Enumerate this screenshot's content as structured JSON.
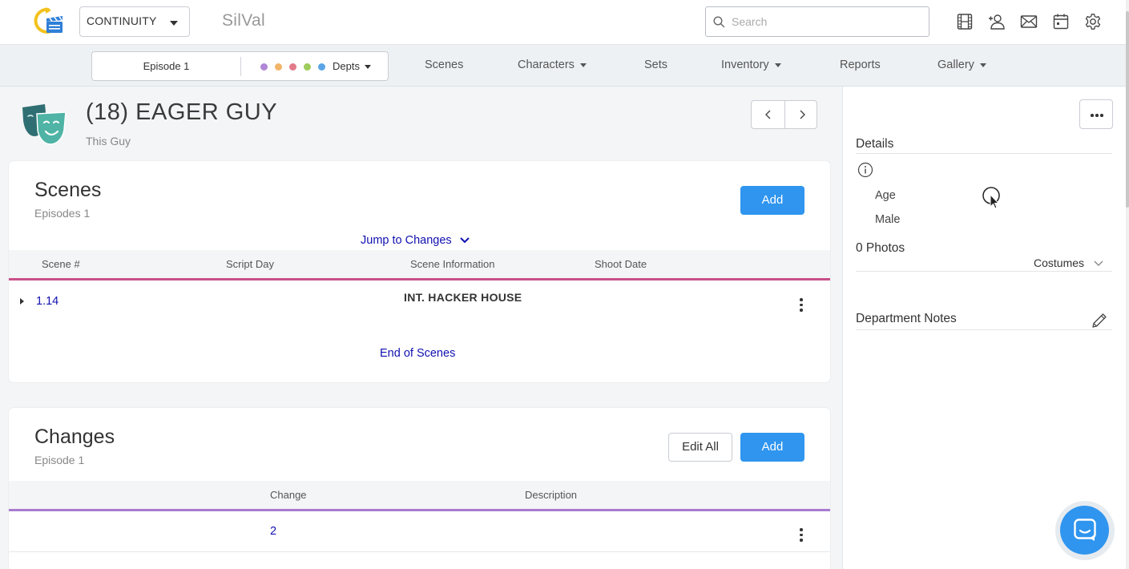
{
  "topbar": {
    "app_select": "CONTINUITY",
    "project_name": "SilVal",
    "search_placeholder": "Search",
    "icons": [
      "film-icon",
      "add-user-icon",
      "mail-icon",
      "calendar-icon",
      "gear-icon"
    ]
  },
  "nav": {
    "episode": "Episode 1",
    "depts_label": "Depts",
    "dept_colors": [
      "#b186d6",
      "#f2b466",
      "#e27a8a",
      "#9fcc5b",
      "#5aa5e6"
    ],
    "items": [
      {
        "label": "Scenes",
        "dropdown": false
      },
      {
        "label": "Characters",
        "dropdown": true
      },
      {
        "label": "Sets",
        "dropdown": false
      },
      {
        "label": "Inventory",
        "dropdown": true
      },
      {
        "label": "Reports",
        "dropdown": false
      },
      {
        "label": "Gallery",
        "dropdown": true
      }
    ]
  },
  "character": {
    "title": "(18) EAGER GUY",
    "subtitle": "This Guy"
  },
  "scenes_card": {
    "title": "Scenes",
    "subtitle": "Episodes 1",
    "add_label": "Add",
    "jump_label": "Jump to Changes",
    "columns": [
      "Scene #",
      "Script Day",
      "Scene Information",
      "Shoot Date"
    ],
    "row_line_color": "#c9508a",
    "rows": [
      {
        "scene": "1.14",
        "script_day": "",
        "info": "INT. HACKER HOUSE",
        "shoot_date": ""
      }
    ],
    "end_label": "End of Scenes"
  },
  "changes_card": {
    "title": "Changes",
    "subtitle": "Episode 1",
    "edit_all_label": "Edit All",
    "add_label": "Add",
    "columns": [
      "Change",
      "Description"
    ],
    "row_line_color": "#a77bd0",
    "rows": [
      {
        "change": "2",
        "description": ""
      }
    ]
  },
  "details_panel": {
    "details_heading": "Details",
    "age_label": "Age",
    "gender": "Male",
    "photos_label": "0 Photos",
    "photos_filter": "Costumes",
    "dept_notes_heading": "Department Notes"
  },
  "colors": {
    "primary": "#2f95ef",
    "link": "#1010b0",
    "mask_teal": "#3aa59a"
  }
}
